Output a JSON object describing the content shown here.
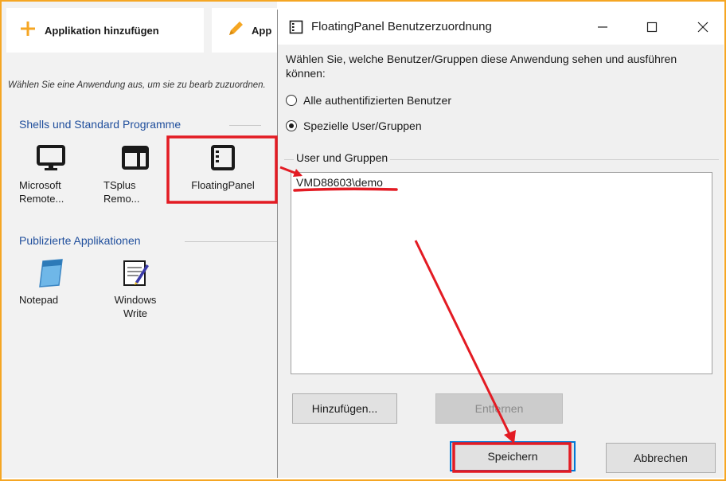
{
  "left_app": {
    "toolbar": {
      "add_label": "Applikation hinzufügen",
      "edit_label": "App"
    },
    "hint_text": "Wählen Sie eine Anwendung aus, um sie zu bearb zuzuordnen.",
    "section_shells": "Shells und Standard Programme",
    "section_published": "Publizierte Applikationen",
    "apps_shells": [
      {
        "label": "Microsoft Remote...",
        "icon": "monitor-icon"
      },
      {
        "label": "TSplus Remo...",
        "icon": "window-icon"
      },
      {
        "label": "FloatingPanel",
        "icon": "floating-panel-icon"
      }
    ],
    "apps_published": [
      {
        "label": "Notepad",
        "icon": "notepad-icon"
      },
      {
        "label": "Windows Write",
        "icon": "write-icon"
      }
    ]
  },
  "dialog": {
    "title": "FloatingPanel Benutzerzuordnung",
    "description": "Wählen Sie, welche Benutzer/Gruppen diese Anwendung sehen und ausführen können:",
    "radio_all": "Alle authentifizierten Benutzer",
    "radio_specific": "Spezielle User/Gruppen",
    "selected_option": "Spezielle User/Gruppen",
    "group_label": "User und Gruppen",
    "list_items": [
      "VMD88603\\demo"
    ],
    "add_button": "Hinzufügen...",
    "remove_button": "Entfernen",
    "save_button": "Speichern",
    "cancel_button": "Abbrechen"
  },
  "colors": {
    "frame": "#f5a623",
    "annotation": "#e31b23",
    "section_heading": "#1f4e9c",
    "primary_border": "#0078d7"
  }
}
